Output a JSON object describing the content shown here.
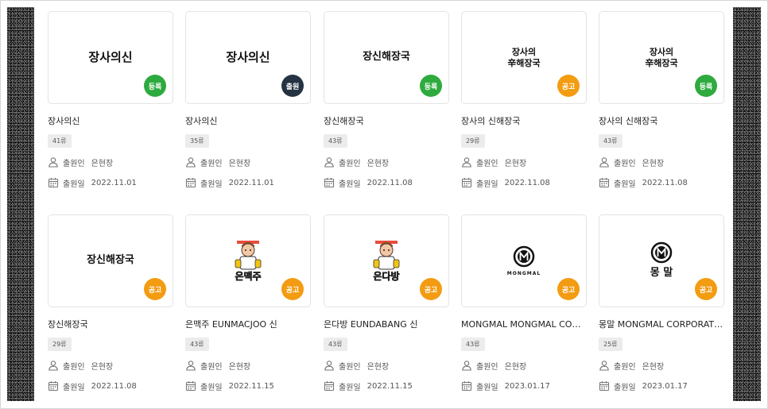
{
  "cards": [
    {
      "mark": "장사의신",
      "mark_style": "lg",
      "badge": "등록",
      "badge_color": "green",
      "title": "장사의신",
      "class": "41류",
      "applicant_label": "출원인",
      "applicant": "은현장",
      "date_label": "출원일",
      "date": "2022.11.01"
    },
    {
      "mark": "장사의신",
      "mark_style": "lg",
      "badge": "출원",
      "badge_color": "navy",
      "title": "장사의신",
      "class": "35류",
      "applicant_label": "출원인",
      "applicant": "은현장",
      "date_label": "출원일",
      "date": "2022.11.01"
    },
    {
      "mark": "장신해장국",
      "mark_style": "md",
      "badge": "등록",
      "badge_color": "green",
      "title": "장신해장국",
      "class": "43류",
      "applicant_label": "출원인",
      "applicant": "은현장",
      "date_label": "출원일",
      "date": "2022.11.08"
    },
    {
      "mark": "장사의\n辛해장국",
      "mark_style": "sm",
      "badge": "공고",
      "badge_color": "orange",
      "title": "장사의 신해장국",
      "class": "29류",
      "applicant_label": "출원인",
      "applicant": "은현장",
      "date_label": "출원일",
      "date": "2022.11.08"
    },
    {
      "mark": "장사의\n辛해장국",
      "mark_style": "sm",
      "badge": "등록",
      "badge_color": "green",
      "title": "장사의 신해장국",
      "class": "43류",
      "applicant_label": "출원인",
      "applicant": "은현장",
      "date_label": "출원일",
      "date": "2022.11.08"
    },
    {
      "mark": "장신해장국",
      "mark_style": "md",
      "badge": "공고",
      "badge_color": "orange",
      "title": "장신해장국",
      "class": "29류",
      "applicant_label": "출원인",
      "applicant": "은현장",
      "date_label": "출원일",
      "date": "2022.11.08"
    },
    {
      "mark": "은맥주",
      "mark_style": "cartoon",
      "badge": "공고",
      "badge_color": "orange",
      "title": "은맥주 EUNMACJOO 신",
      "class": "43류",
      "applicant_label": "출원인",
      "applicant": "은현장",
      "date_label": "출원일",
      "date": "2022.11.15"
    },
    {
      "mark": "은다방",
      "mark_style": "cartoon",
      "badge": "공고",
      "badge_color": "orange",
      "title": "은다방 EUNDABANG 신",
      "class": "43류",
      "applicant_label": "출원인",
      "applicant": "은현장",
      "date_label": "출원일",
      "date": "2022.11.15"
    },
    {
      "mark": "MONGMAL",
      "mark_style": "mong",
      "badge": "공고",
      "badge_color": "orange",
      "title": "MONGMAL MONGMAL CORPORATION",
      "class": "43류",
      "applicant_label": "출원인",
      "applicant": "은현장",
      "date_label": "출원일",
      "date": "2023.01.17"
    },
    {
      "mark": "몽 말",
      "mark_style": "mong",
      "badge": "공고",
      "badge_color": "orange",
      "title": "몽말 MONGMAL CORPORATION",
      "class": "25류",
      "applicant_label": "출원인",
      "applicant": "은현장",
      "date_label": "출원일",
      "date": "2023.01.17"
    }
  ],
  "colors": {
    "green": "#2eaa3f",
    "navy": "#253342",
    "orange": "#f39c12"
  }
}
